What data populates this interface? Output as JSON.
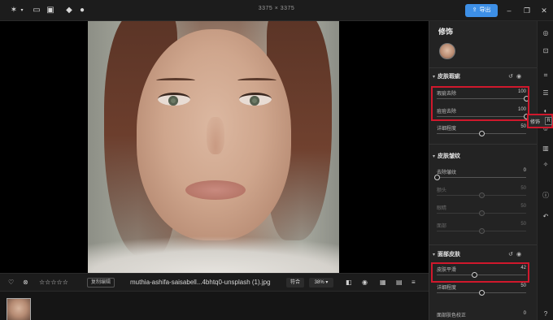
{
  "topbar": {
    "dimensions": "3375 × 3375",
    "export_label": "导出",
    "icons": [
      "logo-star-icon",
      "folder-icon",
      "image-icon",
      "eraser-icon",
      "magnify-icon"
    ]
  },
  "bottombar": {
    "rating": [
      "☆",
      "☆",
      "☆",
      "☆",
      "☆"
    ],
    "copy_edit_label": "复制编辑",
    "filename": "muthia-ashifa-saisabell...4bhtq0-unsplash (1).jpg",
    "fit_label": "符合",
    "zoom_value": "38%"
  },
  "panel": {
    "title": "修饰",
    "sections": {
      "skin_blemish": {
        "title": "皮肤瑕疵",
        "sliders": [
          {
            "label": "瑕疵去除",
            "value": "100",
            "level": 1.0
          },
          {
            "label": "痘痘去除",
            "value": "100",
            "level": 1.0
          },
          {
            "label": "详细程度",
            "value": "50",
            "level": 0.5
          }
        ]
      },
      "skin_texture": {
        "title": "皮肤皱纹",
        "sliders": [
          {
            "label": "去除皱纹",
            "value": "0",
            "level": 0.0
          },
          {
            "label": "额头",
            "value": "50",
            "level": 0.5
          },
          {
            "label": "眼睛",
            "value": "50",
            "level": 0.5
          },
          {
            "label": "面部",
            "value": "50",
            "level": 0.5
          }
        ]
      },
      "face_skin": {
        "title": "面部皮肤",
        "sliders": [
          {
            "label": "皮肤平滑",
            "value": "42",
            "level": 0.42
          },
          {
            "label": "详细程度",
            "value": "50",
            "level": 0.5
          },
          {
            "label": "面部肤色校正",
            "value": "0",
            "level": 0.0
          }
        ]
      }
    }
  },
  "tooltip": {
    "label": "修饰",
    "key": "R"
  },
  "colors": {
    "accent": "#3d8fe6",
    "highlight": "#d0182c",
    "panel_bg": "#232323"
  }
}
